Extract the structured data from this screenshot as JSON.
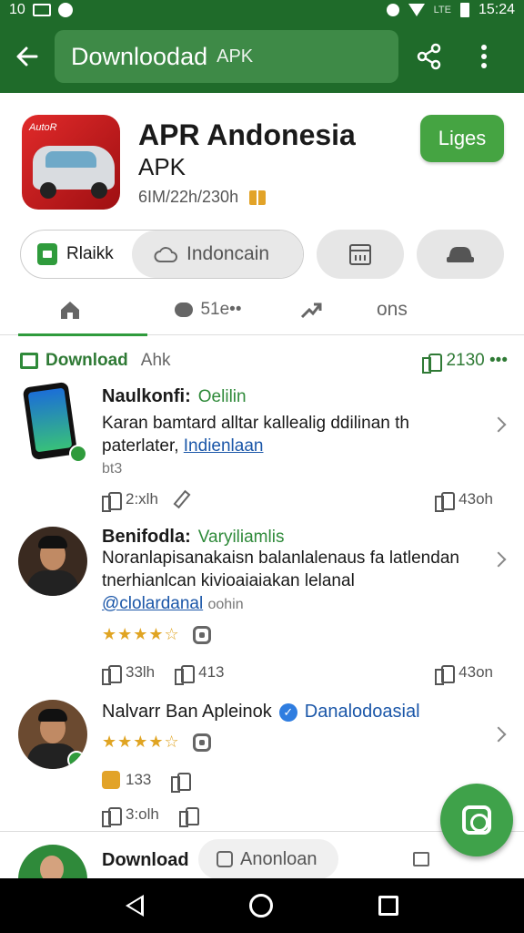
{
  "status_bar": {
    "left_text": "10",
    "time": "15:24",
    "small_text": "LTE"
  },
  "app_bar": {
    "search_text": "Downloodad",
    "search_suffix": "APK"
  },
  "app": {
    "title": "APR Andonesia",
    "subtitle": "APK",
    "meta": "6IM/22h/230h",
    "install_label": "Liges",
    "icon_logo": "AutoR"
  },
  "chips": {
    "chip1_label": "Rlaikk",
    "chip2_label": "Indoncain"
  },
  "tabs": [
    {
      "label": ""
    },
    {
      "label": "51e••"
    },
    {
      "label": ""
    },
    {
      "label": "ons"
    }
  ],
  "section": {
    "title": "Download",
    "subtitle": "Ahk",
    "count": "2130 •••"
  },
  "reviews": [
    {
      "name": "Naulkonfi:",
      "tag": "Oelilin",
      "text_line1": "Karan bamtard alltar kallealig ddilinan th",
      "text_line2_prefix": "paterlater,",
      "text_link": "Indienlaan",
      "text_extra": "bt3",
      "stat1": "2:xlh",
      "stat_right": "43oh"
    },
    {
      "name": "Benifodla:",
      "tag": "Varyiliamlis",
      "text_line1": "Noranlapisanakaisn balanlalenaus fa latlendan",
      "text_line2": "tnerhianlcan kivioaiaiakan lelanal",
      "text_link": "@clolardanal",
      "text_extra": "oohin",
      "stars": "★★★★☆",
      "stat1": "33lh",
      "stat2": "413",
      "stat_right": "43on"
    },
    {
      "name": "Nalvarr Ban Apleinok",
      "tag": "Danalodoasial",
      "stars": "★★★★☆",
      "stat_a": "133",
      "stat1": "3:olh"
    }
  ],
  "bottom_row": {
    "title": "Download",
    "chip_label": "Anonloan"
  },
  "colors": {
    "primary_dark": "#1f6b2a",
    "primary": "#2f9b3c",
    "install": "#45a442",
    "link": "#1a56a8",
    "star": "#e0a422"
  },
  "icons": {
    "back": "arrow-left-icon",
    "share": "share-icon",
    "more": "more-vert-icon",
    "fab": "camera-lens-icon"
  }
}
